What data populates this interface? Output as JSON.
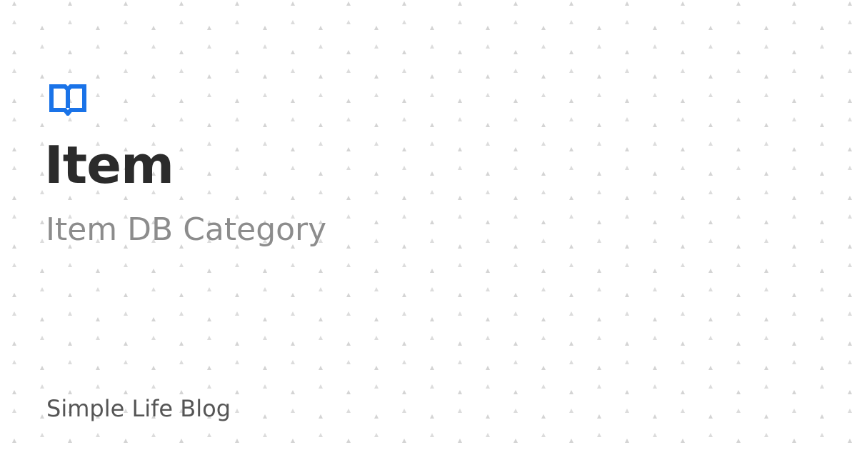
{
  "card": {
    "icon": "open-book-icon",
    "title": "Item",
    "subtitle": "Item DB Category",
    "footer": "Simple Life Blog"
  },
  "colors": {
    "background": "#ffffff",
    "accent": "#1a73e8",
    "title": "#2b2b2b",
    "subtitle": "#8c8c8c",
    "footer": "#555555",
    "pattern": "#d4d4d4"
  }
}
